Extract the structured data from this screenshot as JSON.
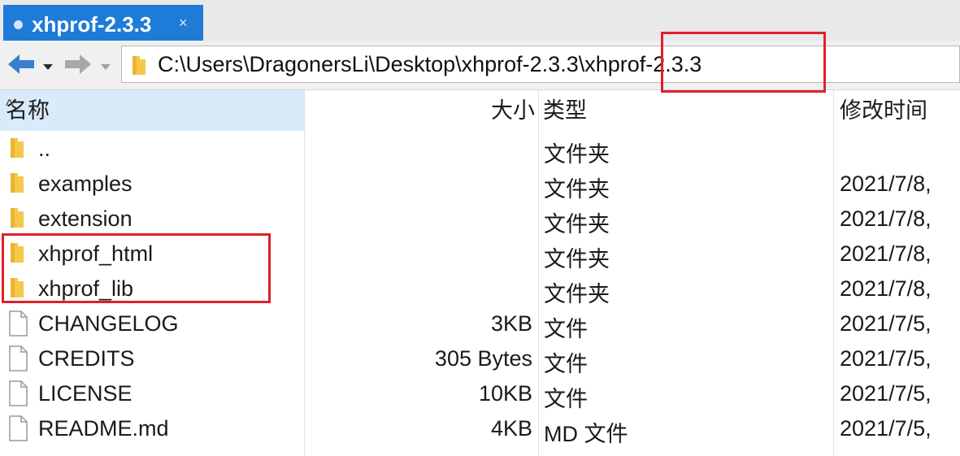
{
  "tab": {
    "title": "xhprof-2.3.3",
    "close": "×"
  },
  "nav": {
    "back_icon": "back-arrow-icon",
    "forward_icon": "forward-arrow-icon"
  },
  "address": {
    "path_prefix": "C:\\Users\\DragonersLi\\Desktop\\xhprof-2.3.3",
    "path_last": "\\xhprof-2.3.3"
  },
  "columns": {
    "name": "名称",
    "size": "大小",
    "type": "类型",
    "modified": "修改时间",
    "sort_indicator": "^"
  },
  "rows": [
    {
      "name": "..",
      "size": "",
      "type": "文件夹",
      "modified": "",
      "icon": "folder-icon"
    },
    {
      "name": "examples",
      "size": "",
      "type": "文件夹",
      "modified": "2021/7/8,",
      "icon": "folder-icon"
    },
    {
      "name": "extension",
      "size": "",
      "type": "文件夹",
      "modified": "2021/7/8,",
      "icon": "folder-icon"
    },
    {
      "name": "xhprof_html",
      "size": "",
      "type": "文件夹",
      "modified": "2021/7/8,",
      "icon": "folder-icon"
    },
    {
      "name": "xhprof_lib",
      "size": "",
      "type": "文件夹",
      "modified": "2021/7/8,",
      "icon": "folder-icon"
    },
    {
      "name": "CHANGELOG",
      "size": "3KB",
      "type": "文件",
      "modified": "2021/7/5,",
      "icon": "file-icon"
    },
    {
      "name": "CREDITS",
      "size": "305 Bytes",
      "type": "文件",
      "modified": "2021/7/5,",
      "icon": "file-icon"
    },
    {
      "name": "LICENSE",
      "size": "10KB",
      "type": "文件",
      "modified": "2021/7/5,",
      "icon": "file-icon"
    },
    {
      "name": "README.md",
      "size": "4KB",
      "type": "MD 文件",
      "modified": "2021/7/5,",
      "icon": "file-icon"
    }
  ],
  "colors": {
    "tab_active": "#1e7bd8",
    "name_header_bg": "#d9ebfa",
    "highlight": "#e0202b",
    "folder": "#f5c84a"
  }
}
